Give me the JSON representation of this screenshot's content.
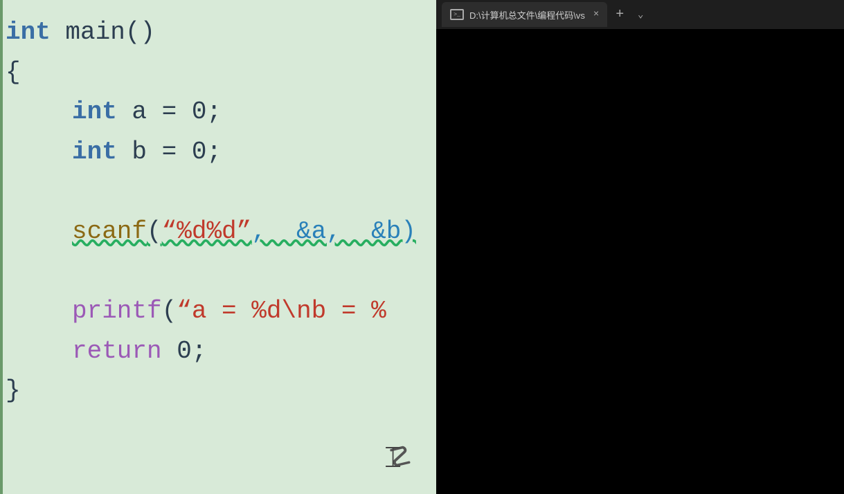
{
  "editor": {
    "background": "#d8ead8",
    "lines": [
      {
        "id": "line1",
        "indent": 0,
        "parts": [
          {
            "text": "int",
            "class": "kw-int"
          },
          {
            "text": " ",
            "class": "punct"
          },
          {
            "text": "main",
            "class": "fn-main"
          },
          {
            "text": "()",
            "class": "punct"
          }
        ]
      },
      {
        "id": "line2",
        "indent": 0,
        "parts": [
          {
            "text": "{",
            "class": "punct"
          }
        ]
      },
      {
        "id": "line3",
        "indent": 1,
        "parts": [
          {
            "text": "int",
            "class": "kw-int"
          },
          {
            "text": " ",
            "class": "punct"
          },
          {
            "text": "a = 0;",
            "class": "punct"
          }
        ]
      },
      {
        "id": "line4",
        "indent": 1,
        "parts": [
          {
            "text": "int",
            "class": "kw-int"
          },
          {
            "text": " ",
            "class": "punct"
          },
          {
            "text": "b = 0;",
            "class": "punct"
          }
        ]
      },
      {
        "id": "line5",
        "indent": 1,
        "parts": [
          {
            "text": "scanf",
            "class": "fn-scanf",
            "squiggly": true
          },
          {
            "text": "(",
            "class": "punct",
            "squiggly": true
          },
          {
            "text": "“%d%d”",
            "class": "str",
            "squiggly": true
          },
          {
            "text": ",  &a,  &b)",
            "class": "amp",
            "squiggly": true
          }
        ]
      },
      {
        "id": "line6",
        "indent": 1,
        "parts": [
          {
            "text": "printf",
            "class": "fn-printf"
          },
          {
            "text": "(",
            "class": "punct"
          },
          {
            "text": "“a = %d\\nb = %",
            "class": "str"
          }
        ]
      },
      {
        "id": "line7",
        "indent": 1,
        "parts": [
          {
            "text": "return",
            "class": "kw-return"
          },
          {
            "text": " 0;",
            "class": "punct"
          }
        ]
      },
      {
        "id": "line8",
        "indent": 0,
        "parts": [
          {
            "text": "}",
            "class": "punct"
          }
        ]
      }
    ]
  },
  "terminal": {
    "tab_title": "D:\\计算机总文件\\编程代码\\vs",
    "add_label": "+",
    "dropdown_label": "⌄",
    "close_label": "×"
  }
}
